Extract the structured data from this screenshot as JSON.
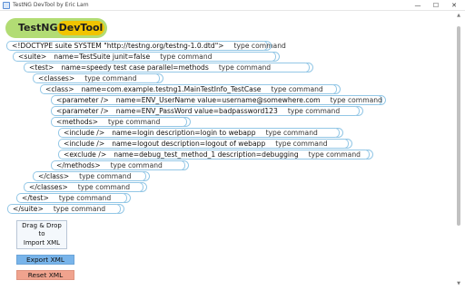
{
  "window": {
    "title": "TestNG DevTool by Eric Lam",
    "controls": {
      "minimize": "—",
      "maximize": "☐",
      "close": "✕"
    },
    "icons": [
      "app-icon",
      "minimize-icon",
      "maximize-icon",
      "close-icon",
      "scroll-up-arrow-icon",
      "scroll-down-arrow-icon"
    ]
  },
  "logo": {
    "left": "TestNG",
    "right": "DevTool",
    "colors": {
      "green": "#b2dc74",
      "yellow": "#f1c400"
    }
  },
  "type_command_label": "type command",
  "xml_lines": [
    {
      "tag": "<!DOCTYPE suite SYSTEM \"http://testng.org/testng-1.0.dtd\">",
      "attrs": "",
      "type": "type command"
    },
    {
      "tag": "<suite>",
      "attrs": "name=TestSuite    junit=false",
      "type": "type command"
    },
    {
      "tag": "<test>",
      "attrs": "name=speedy test case    parallel=methods",
      "type": "type command"
    },
    {
      "tag": "<classes>",
      "attrs": "",
      "type": "type command"
    },
    {
      "tag": "<class>",
      "attrs": "name=com.example.testng1.MainTestInfo_TestCase",
      "type": "type command"
    },
    {
      "tag": "<parameter />",
      "attrs": "name=ENV_UserName    value=username@somewhere.com",
      "type": "type command"
    },
    {
      "tag": "<parameter />",
      "attrs": "name=ENV_PassWord    value=badpassword123",
      "type": "type command"
    },
    {
      "tag": "<methods>",
      "attrs": "",
      "type": "type command"
    },
    {
      "tag": "<include />",
      "attrs": "name=login    description=login to webapp",
      "type": "type command"
    },
    {
      "tag": "<include />",
      "attrs": "name=logout    description=logout of webapp",
      "type": "type command"
    },
    {
      "tag": "<exclude />",
      "attrs": "name=debug_test_method_1    description=debugging",
      "type": "type command"
    },
    {
      "tag": "</methods>",
      "attrs": "",
      "type": "type command"
    },
    {
      "tag": "</class>",
      "attrs": "",
      "type": "type command"
    },
    {
      "tag": "</classes>",
      "attrs": "",
      "type": "type command"
    },
    {
      "tag": "</test>",
      "attrs": "",
      "type": "type command"
    },
    {
      "tag": "</suite>",
      "attrs": "",
      "type": "type command"
    }
  ],
  "dropzone": {
    "label": "Drag & Drop\nto\nImport XML"
  },
  "buttons": {
    "export": "Export XML",
    "reset": "Reset XML"
  },
  "colors": {
    "line_border": "#93c7e6",
    "export_bg": "#78b4ea",
    "reset_bg": "#f0a38e"
  }
}
